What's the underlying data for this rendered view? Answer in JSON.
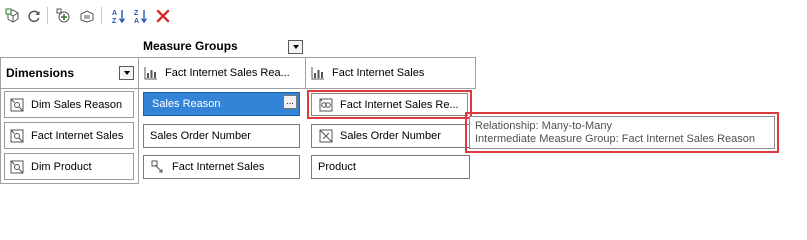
{
  "toolbar": {
    "buttons": [
      {
        "name": "add-cube-dimension-button",
        "icon": "cube-add-icon"
      },
      {
        "name": "refresh-button",
        "icon": "refresh-icon"
      },
      {
        "name": "add-measure-group-button",
        "icon": "measure-group-add-icon"
      },
      {
        "name": "organize-button",
        "icon": "organize-icon"
      },
      {
        "name": "sort-ascending-button",
        "icon": "sort-az-icon"
      },
      {
        "name": "sort-descending-button",
        "icon": "sort-za-icon"
      },
      {
        "name": "delete-button",
        "icon": "delete-x-icon"
      }
    ],
    "colors": {
      "delete": "#d92b2b",
      "sort_blue": "#2256b8"
    }
  },
  "measure_groups_label": "Measure Groups",
  "dimensions_label": "Dimensions",
  "measure_group_columns": [
    {
      "label": "Fact Internet Sales Rea..."
    },
    {
      "label": "Fact Internet Sales"
    }
  ],
  "dimensions": [
    {
      "label": "Dim Sales Reason"
    },
    {
      "label": "Fact Internet Sales"
    },
    {
      "label": "Dim Product"
    }
  ],
  "cells": {
    "r0c0": {
      "label": "Sales Reason",
      "selected": true,
      "ellipsis": "..."
    },
    "r0c1": {
      "label": "Fact Internet Sales Re...",
      "icon": "many-to-many-icon"
    },
    "r1c0": {
      "label": "Sales Order Number"
    },
    "r1c1": {
      "label": "Sales Order Number",
      "icon": "fact-dimension-icon"
    },
    "r2c0": {
      "label": "Fact Internet Sales",
      "icon": "reference-relationship-icon"
    },
    "r2c1": {
      "label": "Product"
    }
  },
  "tooltip": {
    "line1": "Relationship: Many-to-Many",
    "line2": "Intermediate Measure Group: Fact Internet Sales Reason"
  },
  "colors": {
    "selection": "#3384d7",
    "highlight": "#e0393e"
  }
}
